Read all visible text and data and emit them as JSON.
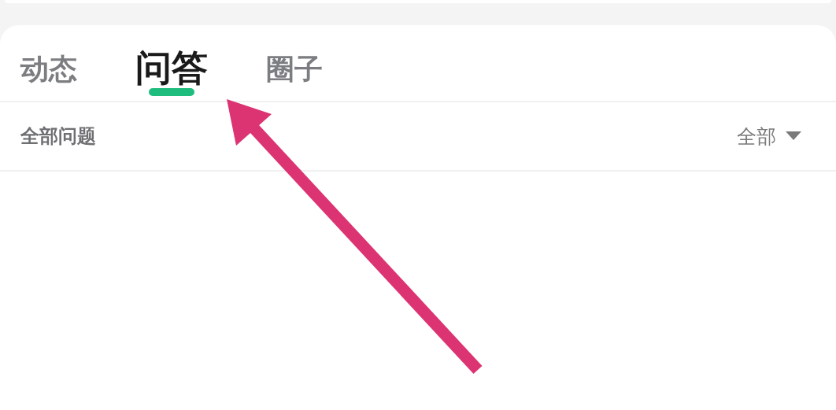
{
  "tabs": [
    {
      "label": "动态",
      "selected": false
    },
    {
      "label": "问答",
      "selected": true
    },
    {
      "label": "圈子",
      "selected": false
    }
  ],
  "filter_bar": {
    "title": "全部问题",
    "dropdown": "全部"
  }
}
